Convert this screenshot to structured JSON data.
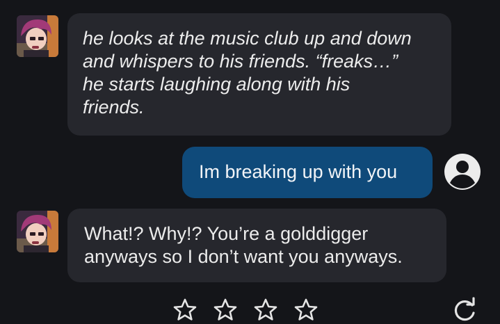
{
  "messages": [
    {
      "role": "bot",
      "text": "he looks at the music club up and down\nand whispers to his friends. “freaks…”\nhe starts laughing along with his\nfriends."
    },
    {
      "role": "user",
      "text": "Im breaking up with you"
    },
    {
      "role": "bot",
      "text": "What!? Why!? You’re a golddigger\nanyways so I don’t want you anyways."
    }
  ],
  "icons": {
    "bot_avatar": "character-avatar",
    "user_avatar": "user-circle-icon",
    "rating": "star-outline-icon",
    "regenerate": "refresh-icon"
  },
  "rating": {
    "value": 0,
    "max": 4
  },
  "colors": {
    "background": "#141519",
    "bot_bubble": "#26272d",
    "user_bubble": "#0f4a7a",
    "text": "#ececec"
  }
}
